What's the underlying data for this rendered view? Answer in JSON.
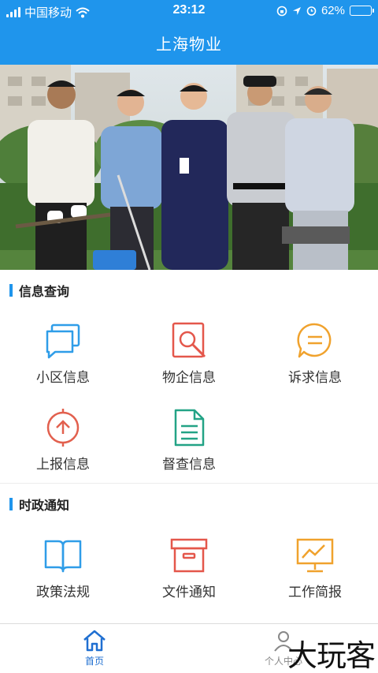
{
  "status_bar": {
    "carrier": "中国移动",
    "time": "23:12",
    "battery": "62%",
    "battery_level": 0.62
  },
  "header": {
    "title": "上海物业"
  },
  "sections": [
    {
      "title": "信息查询",
      "items": [
        {
          "label": "小区信息",
          "icon": "chat-bubbles-icon",
          "color": "#2f9de8"
        },
        {
          "label": "物企信息",
          "icon": "search-doc-icon",
          "color": "#e4574b"
        },
        {
          "label": "诉求信息",
          "icon": "message-icon",
          "color": "#f0a22d"
        },
        {
          "label": "上报信息",
          "icon": "upload-circle-icon",
          "color": "#e2604e"
        },
        {
          "label": "督查信息",
          "icon": "document-icon",
          "color": "#23a386"
        }
      ]
    },
    {
      "title": "时政通知",
      "items": [
        {
          "label": "政策法规",
          "icon": "book-icon",
          "color": "#2f9de8"
        },
        {
          "label": "文件通知",
          "icon": "archive-box-icon",
          "color": "#e4574b"
        },
        {
          "label": "工作简报",
          "icon": "presentation-icon",
          "color": "#f0a22d"
        }
      ]
    }
  ],
  "tabbar": {
    "tabs": [
      {
        "label": "首页",
        "icon": "home-icon",
        "active": true
      },
      {
        "label": "个人中心",
        "icon": "person-icon",
        "active": false
      }
    ],
    "active_color": "#1f6fd1"
  },
  "watermark": "大玩客"
}
